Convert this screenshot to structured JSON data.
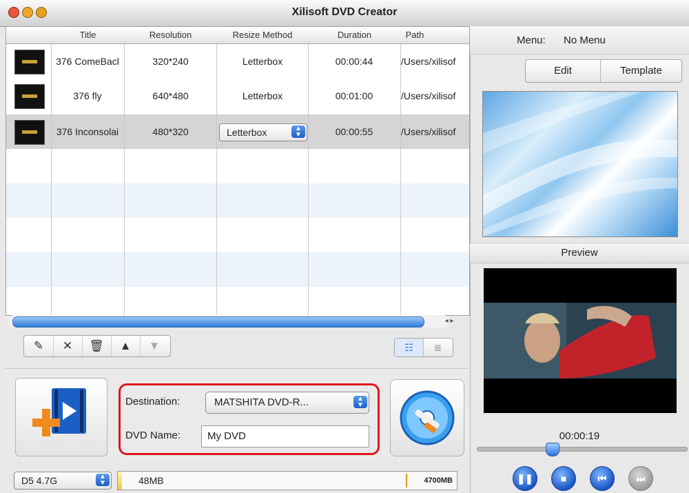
{
  "window": {
    "title": "Xilisoft DVD Creator"
  },
  "table": {
    "headers": [
      "Title",
      "Resolution",
      "Resize Method",
      "Duration",
      "Path"
    ],
    "rows": [
      {
        "title": "376 ComeBacl",
        "resolution": "320*240",
        "resize": "Letterbox",
        "duration": "00:00:44",
        "path": "/Users/xilisof"
      },
      {
        "title": "376 fly",
        "resolution": "640*480",
        "resize": "Letterbox",
        "duration": "00:01:00",
        "path": "/Users/xilisof"
      },
      {
        "title": "376 Inconsolai",
        "resolution": "480*320",
        "resize": "Letterbox",
        "duration": "00:00:55",
        "path": "/Users/xilisof"
      }
    ]
  },
  "output": {
    "destination_label": "Destination:",
    "destination_value": "MATSHITA DVD-R...",
    "dvdname_label": "DVD Name:",
    "dvdname_value": "My DVD"
  },
  "status": {
    "disc_type": "D5 4.7G",
    "used": "48MB",
    "capacity": "4700MB",
    "used_fraction": 0.0102
  },
  "menu_panel": {
    "menu_label": "Menu:",
    "menu_value": "No Menu",
    "edit_label": "Edit",
    "template_label": "Template"
  },
  "preview": {
    "label": "Preview",
    "timecode": "00:00:19"
  },
  "colors": {
    "highlight_border": "#e0161b",
    "accent_blue": "#2c75d8"
  }
}
